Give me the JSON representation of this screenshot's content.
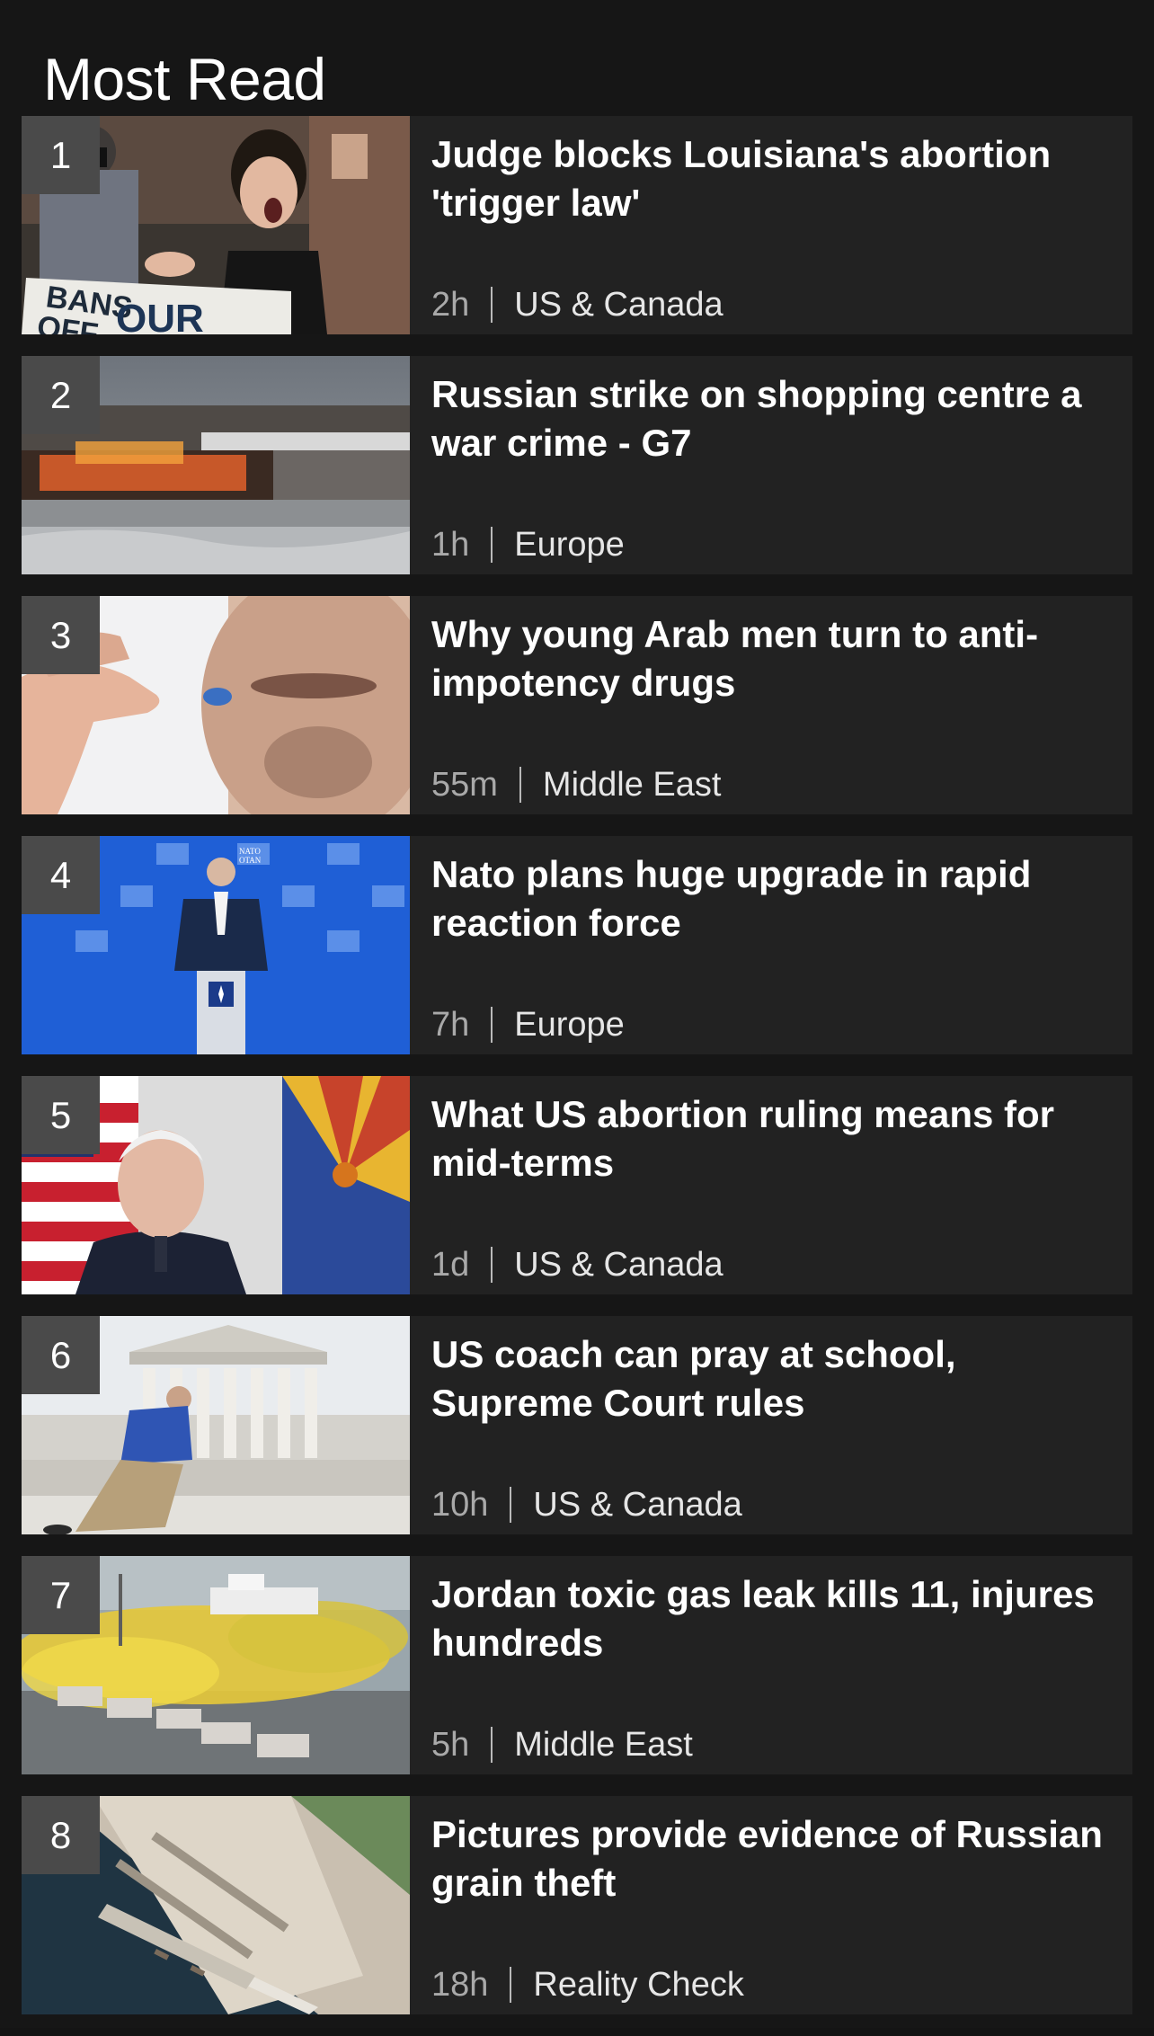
{
  "section": {
    "title": "Most Read"
  },
  "items": [
    {
      "rank": "1",
      "headline": "Judge blocks Louisiana's abortion 'trigger law'",
      "time": "2h",
      "category": "US & Canada",
      "image_text": [
        "BANS",
        "OFF",
        "OUR"
      ]
    },
    {
      "rank": "2",
      "headline": "Russian strike on shopping centre a war crime - G7",
      "time": "1h",
      "category": "Europe"
    },
    {
      "rank": "3",
      "headline": "Why young Arab men turn to anti-impotency drugs",
      "time": "55m",
      "category": "Middle East"
    },
    {
      "rank": "4",
      "headline": "Nato plans huge upgrade in rapid reaction force",
      "time": "7h",
      "category": "Europe",
      "image_text": [
        "NATO",
        "OTAN"
      ]
    },
    {
      "rank": "5",
      "headline": "What US abortion ruling means for mid-terms",
      "time": "1d",
      "category": "US & Canada"
    },
    {
      "rank": "6",
      "headline": "US coach can pray at school, Supreme Court rules",
      "time": "10h",
      "category": "US & Canada"
    },
    {
      "rank": "7",
      "headline": "Jordan toxic gas leak kills 11, injures hundreds",
      "time": "5h",
      "category": "Middle East"
    },
    {
      "rank": "8",
      "headline": "Pictures provide evidence of Russian grain theft",
      "time": "18h",
      "category": "Reality Check"
    }
  ],
  "colors": {
    "background": "#161616",
    "card": "#222222",
    "rank_badge": "#4a4a4a",
    "time_text": "#a9a9a9"
  }
}
